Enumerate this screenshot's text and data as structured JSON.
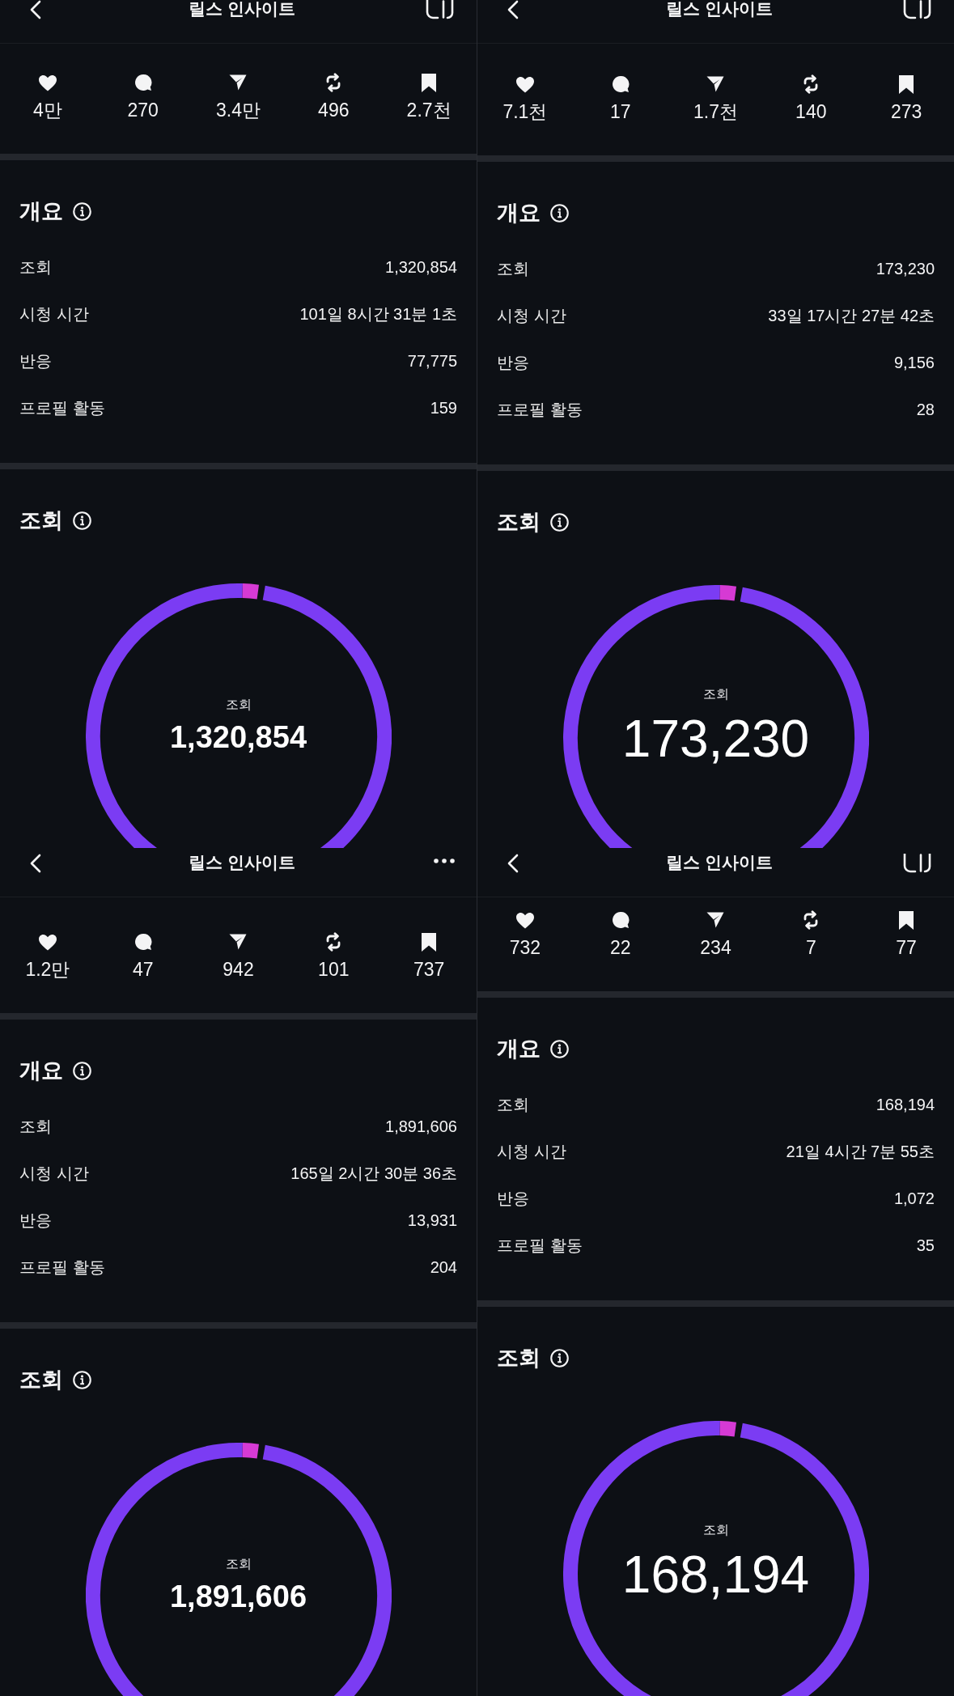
{
  "panels": [
    {
      "header": {
        "title": "릴스 인사이트",
        "action": {
          "kind": "layout"
        }
      },
      "stats": [
        {
          "kind": "likes",
          "count": "4만"
        },
        {
          "kind": "comments",
          "count": "270"
        },
        {
          "kind": "shares",
          "count": "3.4만"
        },
        {
          "kind": "reposts",
          "count": "496"
        },
        {
          "kind": "saves",
          "count": "2.7천"
        }
      ],
      "overview": {
        "title": "개요",
        "rows": [
          {
            "label": "조회",
            "value": "1,320,854"
          },
          {
            "label": "시청 시간",
            "value": "101일 8시간 31분 1초"
          },
          {
            "label": "반응",
            "value": "77,775"
          },
          {
            "label": "프로필 활동",
            "value": "159"
          }
        ]
      },
      "views": {
        "title": "조회",
        "center_label": "조회",
        "center_value": "1,320,854"
      }
    },
    {
      "header": {
        "title": "릴스 인사이트",
        "action": {
          "kind": "layout"
        }
      },
      "stats": [
        {
          "kind": "likes",
          "count": "7.1천"
        },
        {
          "kind": "comments",
          "count": "17"
        },
        {
          "kind": "shares",
          "count": "1.7천"
        },
        {
          "kind": "reposts",
          "count": "140"
        },
        {
          "kind": "saves",
          "count": "273"
        }
      ],
      "overview": {
        "title": "개요",
        "rows": [
          {
            "label": "조회",
            "value": "173,230"
          },
          {
            "label": "시청 시간",
            "value": "33일 17시간 27분 42초"
          },
          {
            "label": "반응",
            "value": "9,156"
          },
          {
            "label": "프로필 활동",
            "value": "28"
          }
        ]
      },
      "views": {
        "title": "조회",
        "center_label": "조회",
        "center_value": "173,230"
      }
    },
    {
      "header": {
        "title": "릴스 인사이트",
        "action": {
          "kind": "more"
        }
      },
      "stats": [
        {
          "kind": "likes",
          "count": "1.2만"
        },
        {
          "kind": "comments",
          "count": "47"
        },
        {
          "kind": "shares",
          "count": "942"
        },
        {
          "kind": "reposts",
          "count": "101"
        },
        {
          "kind": "saves",
          "count": "737"
        }
      ],
      "overview": {
        "title": "개요",
        "rows": [
          {
            "label": "조회",
            "value": "1,891,606"
          },
          {
            "label": "시청 시간",
            "value": "165일 2시간 30분 36초"
          },
          {
            "label": "반응",
            "value": "13,931"
          },
          {
            "label": "프로필 활동",
            "value": "204"
          }
        ]
      },
      "views": {
        "title": "조회",
        "center_label": "조회",
        "center_value": "1,891,606"
      }
    },
    {
      "header": {
        "title": "릴스 인사이트",
        "action": {
          "kind": "layout"
        }
      },
      "stats": [
        {
          "kind": "likes",
          "count": "732"
        },
        {
          "kind": "comments",
          "count": "22"
        },
        {
          "kind": "shares",
          "count": "234"
        },
        {
          "kind": "reposts",
          "count": "7"
        },
        {
          "kind": "saves",
          "count": "77"
        }
      ],
      "overview": {
        "title": "개요",
        "rows": [
          {
            "label": "조회",
            "value": "168,194"
          },
          {
            "label": "시청 시간",
            "value": "21일 4시간 7분 55초"
          },
          {
            "label": "반응",
            "value": "1,072"
          },
          {
            "label": "프로필 활동",
            "value": "35"
          }
        ]
      },
      "views": {
        "title": "조회",
        "center_label": "조회",
        "center_value": "168,194"
      }
    }
  ]
}
